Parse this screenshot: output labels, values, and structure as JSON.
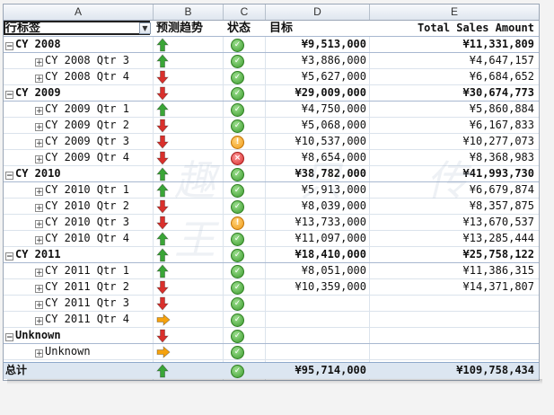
{
  "columns": [
    "A",
    "B",
    "C",
    "D",
    "E"
  ],
  "header": {
    "row_labels": "行标签",
    "trend": "预测趋势",
    "status": "状态",
    "target": "目标",
    "sales": "Total Sales Amount"
  },
  "rows": [
    {
      "kind": "year",
      "label": "CY 2008",
      "trend": "up",
      "status": "ok",
      "target": "¥9,513,000",
      "sales": "¥11,331,809"
    },
    {
      "kind": "qtr",
      "label": "CY 2008 Qtr 3",
      "trend": "up",
      "status": "ok",
      "target": "¥3,886,000",
      "sales": "¥4,647,157"
    },
    {
      "kind": "qtr",
      "label": "CY 2008 Qtr 4",
      "trend": "down",
      "status": "ok",
      "target": "¥5,627,000",
      "sales": "¥6,684,652"
    },
    {
      "kind": "year",
      "label": "CY 2009",
      "trend": "down",
      "status": "ok",
      "target": "¥29,009,000",
      "sales": "¥30,674,773"
    },
    {
      "kind": "qtr",
      "label": "CY 2009 Qtr 1",
      "trend": "up",
      "status": "ok",
      "target": "¥4,750,000",
      "sales": "¥5,860,884"
    },
    {
      "kind": "qtr",
      "label": "CY 2009 Qtr 2",
      "trend": "down",
      "status": "ok",
      "target": "¥5,068,000",
      "sales": "¥6,167,833"
    },
    {
      "kind": "qtr",
      "label": "CY 2009 Qtr 3",
      "trend": "down",
      "status": "warn",
      "target": "¥10,537,000",
      "sales": "¥10,277,073"
    },
    {
      "kind": "qtr",
      "label": "CY 2009 Qtr 4",
      "trend": "down",
      "status": "bad",
      "target": "¥8,654,000",
      "sales": "¥8,368,983"
    },
    {
      "kind": "year",
      "label": "CY 2010",
      "trend": "up",
      "status": "ok",
      "target": "¥38,782,000",
      "sales": "¥41,993,730"
    },
    {
      "kind": "qtr",
      "label": "CY 2010 Qtr 1",
      "trend": "up",
      "status": "ok",
      "target": "¥5,913,000",
      "sales": "¥6,679,874"
    },
    {
      "kind": "qtr",
      "label": "CY 2010 Qtr 2",
      "trend": "down",
      "status": "ok",
      "target": "¥8,039,000",
      "sales": "¥8,357,875"
    },
    {
      "kind": "qtr",
      "label": "CY 2010 Qtr 3",
      "trend": "down",
      "status": "warn",
      "target": "¥13,733,000",
      "sales": "¥13,670,537"
    },
    {
      "kind": "qtr",
      "label": "CY 2010 Qtr 4",
      "trend": "up",
      "status": "ok",
      "target": "¥11,097,000",
      "sales": "¥13,285,444"
    },
    {
      "kind": "year",
      "label": "CY 2011",
      "trend": "up",
      "status": "ok",
      "target": "¥18,410,000",
      "sales": "¥25,758,122"
    },
    {
      "kind": "qtr",
      "label": "CY 2011 Qtr 1",
      "trend": "up",
      "status": "ok",
      "target": "¥8,051,000",
      "sales": "¥11,386,315"
    },
    {
      "kind": "qtr",
      "label": "CY 2011 Qtr 2",
      "trend": "down",
      "status": "ok",
      "target": "¥10,359,000",
      "sales": "¥14,371,807"
    },
    {
      "kind": "qtr",
      "label": "CY 2011 Qtr 3",
      "trend": "down",
      "status": "ok",
      "target": "",
      "sales": ""
    },
    {
      "kind": "qtr",
      "label": "CY 2011 Qtr 4",
      "trend": "right",
      "status": "ok",
      "target": "",
      "sales": ""
    },
    {
      "kind": "year",
      "label": "Unknown",
      "trend": "down",
      "status": "ok",
      "target": "",
      "sales": ""
    },
    {
      "kind": "qtr",
      "label": "Unknown",
      "trend": "right",
      "status": "ok",
      "target": "",
      "sales": ""
    },
    {
      "kind": "total",
      "label": "总计",
      "trend": "up",
      "status": "ok",
      "target": "¥95,714,000",
      "sales": "¥109,758,434"
    }
  ],
  "icons": {
    "expand": "plus-box-icon",
    "collapse": "minus-box-icon",
    "filter": "dropdown-arrow-icon"
  },
  "colors": {
    "up": "#3aa537",
    "down": "#d9302c",
    "right": "#f5a20e",
    "ok": "#3a9a2c",
    "warn": "#f09b16",
    "bad": "#d62a2a",
    "total_bg": "#dce6f1"
  }
}
